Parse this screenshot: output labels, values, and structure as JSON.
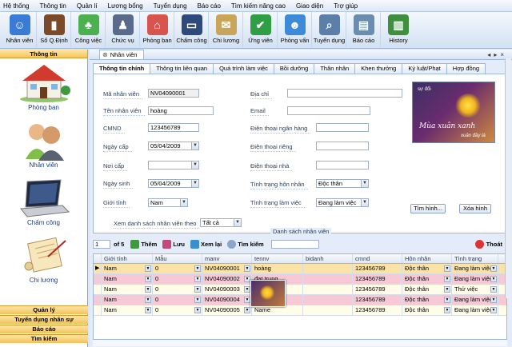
{
  "menu": [
    "Hệ thống",
    "Thông tin",
    "Quản lí",
    "Lương bổng",
    "Tuyển dụng",
    "Báo cáo",
    "Tìm kiếm nâng cao",
    "Giao diện",
    "Trợ giúp"
  ],
  "toolbar": [
    {
      "label": "Nhân viên",
      "icon": "employee-icon",
      "color": "#3a7bd5"
    },
    {
      "label": "Sổ Q.Định",
      "icon": "book-icon",
      "color": "#7a4a2a"
    },
    {
      "label": "Công việc",
      "icon": "work-icon",
      "color": "#4caf50"
    },
    {
      "label": "Chức vụ",
      "icon": "position-icon",
      "color": "#5a6a8a"
    },
    {
      "label": "Phòng ban",
      "icon": "house-icon",
      "color": "#d9534f"
    },
    {
      "label": "Chấm công",
      "icon": "laptop-icon",
      "color": "#2d4a7a"
    },
    {
      "label": "Chi lương",
      "icon": "scroll-icon",
      "color": "#c9a55a"
    },
    {
      "label": "Ứng viên",
      "icon": "candidate-icon",
      "color": "#2f9e44"
    },
    {
      "label": "Phỏng vấn",
      "icon": "interview-icon",
      "color": "#3d8bd8"
    },
    {
      "label": "Tuyển dụng",
      "icon": "recruit-icon",
      "color": "#5b7fa8"
    },
    {
      "label": "Báo cáo",
      "icon": "report-icon",
      "color": "#6a8caf"
    },
    {
      "label": "History",
      "icon": "history-icon",
      "color": "#3f8f3f"
    }
  ],
  "leftnav": {
    "header": "Thông tin",
    "items": [
      "Phòng ban",
      "Nhân viên",
      "Chấm công",
      "Chi lương"
    ],
    "footer": [
      "Quản lý",
      "Tuyển dụng nhân sự",
      "Báo cáo",
      "Tìm kiếm"
    ]
  },
  "doc_tab": "Nhân viên",
  "subtabs": [
    "Thông tin chính",
    "Thông tin liên quan",
    "Quá trình làm việc",
    "Bồi dưỡng",
    "Thân nhân",
    "Khen thưởng",
    "Kỷ luật/Phạt",
    "Hợp đồng"
  ],
  "form": {
    "ma_nv_label": "Mã nhân viên",
    "ma_nv": "NV04090001",
    "ten_label": "Tên nhân viên",
    "ten": "hoàng",
    "cmnd_label": "CMND",
    "cmnd": "123456789",
    "ngaycap_label": "Ngày cấp",
    "ngaycap": "05/04/2009",
    "noicap_label": "Nơi cấp",
    "noicap": "",
    "ngaysinh_label": "Ngày sinh",
    "ngaysinh": "05/04/2009",
    "gioitinh_label": "Giới tính",
    "gioitinh": "Nam",
    "diachi_label": "Địa chỉ",
    "diachi": "",
    "email_label": "Email",
    "email": "",
    "dtnh_label": "Điện thoại ngân hàng",
    "dtnh": "",
    "dtrieng_label": "Điện thoại riêng",
    "dtrieng": "",
    "dtnha_label": "Điện thoại nhà",
    "dtnha": "",
    "honnhan_label": "Tình trạng hôn nhân",
    "honnhan": "Độc thân",
    "lamviec_label": "Tình trạng làm việc",
    "lamviec": "Đang làm việc",
    "btn_timhinh": "Tìm hình...",
    "btn_xoahinh": "Xóa hình",
    "photo_text1": "Mùa xuân xanh",
    "photo_text2": "xuân đầy lá",
    "photo_text3": "sự đổi"
  },
  "filter": {
    "label": "Xem danh sách nhân viên theo",
    "value": "Tất cả"
  },
  "group_title": "Danh sách nhân viên",
  "navbar": {
    "page": "1",
    "of": "of 5",
    "them": "Thêm",
    "luu": "Lưu",
    "xemlai": "Xem lại",
    "timkiem": "Tìm kiếm",
    "thoat": "Thoát"
  },
  "grid": {
    "columns": [
      "Giới tính",
      "Mẫu",
      "manv",
      "tennv",
      "bidanh",
      "cmnd",
      "Hôn nhân",
      "Tình trạng"
    ],
    "rows": [
      [
        "Nam",
        "0",
        "NV04090001",
        "hoàng",
        "",
        "123456789",
        "Độc thân",
        "Đang làm việc"
      ],
      [
        "Nam",
        "0",
        "NV04090002",
        "đạt trung",
        "",
        "123456789",
        "Độc thân",
        "Đang làm việc"
      ],
      [
        "Nam",
        "0",
        "NV04090003",
        "",
        "",
        "123456789",
        "Độc thân",
        "Thử việc"
      ],
      [
        "Nam",
        "0",
        "NV04090004",
        "",
        "",
        "123456789",
        "Độc thân",
        "Đang làm việc"
      ],
      [
        "Nam",
        "0",
        "NV04090005",
        "Name",
        "",
        "123456789",
        "Độc thân",
        "Đang làm việc"
      ]
    ]
  }
}
